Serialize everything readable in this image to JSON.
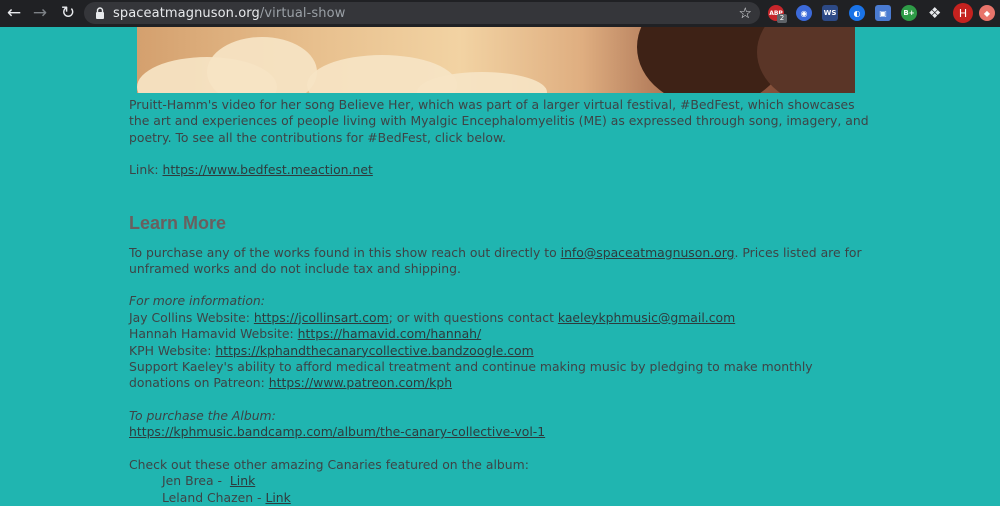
{
  "browser": {
    "url_domain": "spaceatmagnuson.org",
    "url_path": "/virtual-show",
    "extensions": [
      {
        "name": "adblock-plus",
        "label": "ABP",
        "badge": "2"
      },
      {
        "name": "extension-2",
        "label": "◉"
      },
      {
        "name": "extension-3",
        "label": "WS"
      },
      {
        "name": "extension-4",
        "label": "◐"
      },
      {
        "name": "extension-5",
        "label": "▣"
      },
      {
        "name": "extension-6",
        "label": "B+"
      },
      {
        "name": "extension-7",
        "label": "◆"
      }
    ],
    "profile_initial": "H"
  },
  "content": {
    "intro_paragraph": "Pruitt-Hamm's video for her song Believe Her, which was part of a larger virtual festival, #BedFest, which showcases the art and experiences of people living with Myalgic Encephalomyelitis (ME) as expressed through song, imagery, and poetry. To see all the contributions for #BedFest, click below.",
    "link_label": "Link: ",
    "link_url": "https://www.bedfest.meaction.net",
    "learn_more_heading": "Learn More",
    "purchase_text_before": "To purchase any of the works found in this show reach out directly to ",
    "purchase_email": "info@spaceatmagnuson.org",
    "purchase_text_after": ". Prices listed are for unframed works and do not include tax and shipping.",
    "more_info_heading": "For more information:",
    "jay_prefix": "Jay Collins Website: ",
    "jay_url": "https://jcollinsart.com",
    "jay_middle": "; or with questions contact ",
    "jay_email": "kaeleykphmusic@gmail.com",
    "hannah_prefix": "Hannah Hamavid Website: ",
    "hannah_url": "https://hamavid.com/hannah/",
    "kph_prefix": "KPH Website: ",
    "kph_url": "https://kphandthecanarycollective.bandzoogle.com",
    "support_text": "Support Kaeley's ability to afford medical treatment and continue making music by pledging to make monthly donations on Patreon: ",
    "patreon_url": "https://www.patreon.com/kph",
    "album_heading": "To purchase the Album:",
    "album_url": "https://kphmusic.bandcamp.com/album/the-canary-collective-vol-1",
    "canaries_text": "Check out these other amazing Canaries featured on the album:",
    "canaries": [
      {
        "name": "Jen Brea -  ",
        "link": "Link"
      },
      {
        "name": "Leland Chazen - ",
        "link": "Link"
      }
    ]
  }
}
